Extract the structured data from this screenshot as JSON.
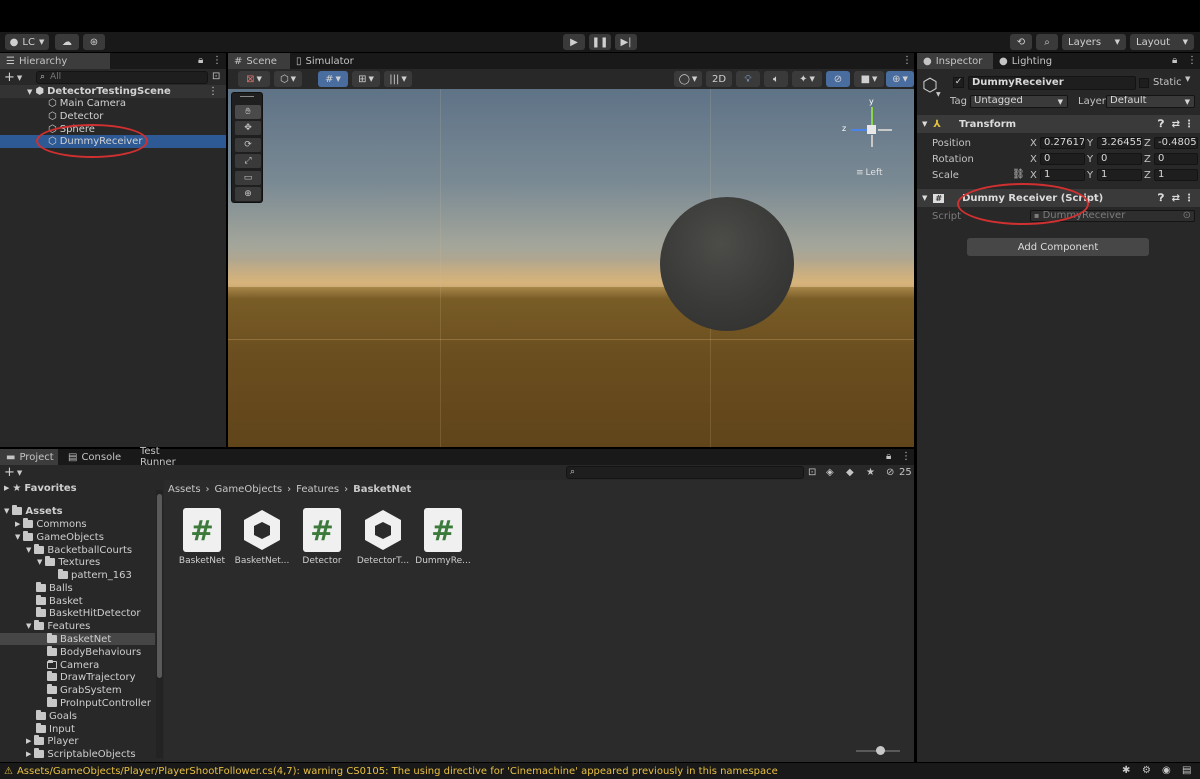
{
  "toolbar": {
    "account": "LC",
    "layers": "Layers",
    "layout": "Layout"
  },
  "hierarchy": {
    "tab": "Hierarchy",
    "search_placeholder": "All",
    "scene": "DetectorTestingScene",
    "items": [
      "Main Camera",
      "Detector",
      "Sphere",
      "DummyReceiver"
    ]
  },
  "scene": {
    "tabs": [
      "Scene",
      "Simulator"
    ],
    "mode_2d": "2D",
    "gizmo_label": "Left",
    "axis_y": "y",
    "axis_z": "z"
  },
  "inspector": {
    "tabs": [
      "Inspector",
      "Lighting"
    ],
    "object_name": "DummyReceiver",
    "static_label": "Static",
    "tag_label": "Tag",
    "tag_value": "Untagged",
    "layer_label": "Layer",
    "layer_value": "Default",
    "transform": {
      "title": "Transform",
      "position_label": "Position",
      "rotation_label": "Rotation",
      "scale_label": "Scale",
      "x": "X",
      "y": "Y",
      "z": "Z",
      "position": [
        "0.27617:",
        "3.26455",
        "-0.4805"
      ],
      "rotation": [
        "0",
        "0",
        "0"
      ],
      "scale": [
        "1",
        "1",
        "1"
      ]
    },
    "script_component": {
      "title": "Dummy Receiver (Script)",
      "script_label": "Script",
      "script_value": "DummyReceiver"
    },
    "add_component": "Add Component"
  },
  "project": {
    "tabs": [
      "Project",
      "Console",
      "Test Runner"
    ],
    "count": "25",
    "favorites": "Favorites",
    "tree": [
      "Assets",
      "Commons",
      "GameObjects",
      "BacketballCourts",
      "Textures",
      "pattern_163",
      "Balls",
      "Basket",
      "BasketHitDetector",
      "Features",
      "BasketNet",
      "BodyBehaviours",
      "Camera",
      "DrawTrajectory",
      "GrabSystem",
      "ProInputController",
      "Goals",
      "Input",
      "Player",
      "ScriptableObjects"
    ],
    "breadcrumb": [
      "Assets",
      "GameObjects",
      "Features",
      "BasketNet"
    ],
    "assets": [
      "BasketNet",
      "BasketNet...",
      "Detector",
      "DetectorT...",
      "DummyRe..."
    ]
  },
  "status": {
    "message": "Assets/GameObjects/Player/PlayerShootFollower.cs(4,7): warning CS0105: The using directive for 'Cinemachine' appeared previously in this namespace"
  },
  "colors": {
    "selection": "#2d5a94",
    "annotation": "#d03030",
    "warning": "#e8c040"
  }
}
